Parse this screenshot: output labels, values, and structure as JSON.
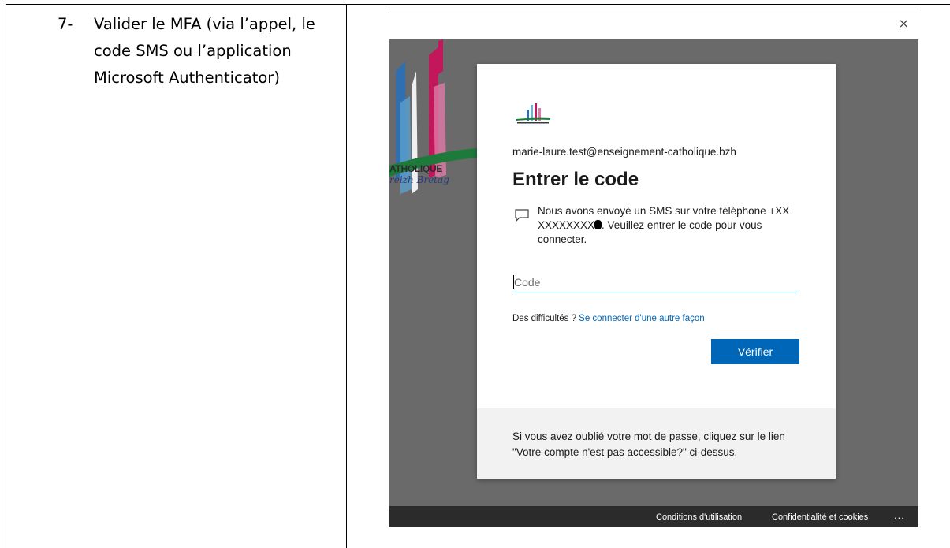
{
  "document": {
    "step_number": "7-",
    "step_text": "Valider le MFA (via l’appel, le code SMS ou l’application Microsoft Authenticator)"
  },
  "window": {
    "close_icon": "close-icon",
    "close_glyph": "×"
  },
  "background": {
    "logo_text": "ATHOLIQUE",
    "logo_subtext": "reizh Bretag"
  },
  "dialog": {
    "email": "marie-laure.test@enseignement-catholique.bzh",
    "title": "Entrer le code",
    "sms_icon": "chat-bubble-icon",
    "message_part1": "Nous avons envoyé un SMS sur votre téléphone +XX XXXXXXXX",
    "message_part2": ". Veuillez entrer le code pour vous connecter.",
    "code_placeholder": "Code",
    "help_prefix": "Des difficultés ? ",
    "help_link": "Se connecter d'une autre façon",
    "verify_label": "Vérifier",
    "footer_text": "Si vous avez oublié votre mot de passe, cliquez sur le lien \"Votre compte n'est pas accessible?\" ci-dessus."
  },
  "bottom_bar": {
    "terms": "Conditions d'utilisation",
    "privacy": "Confidentialité et cookies",
    "more": "..."
  },
  "colors": {
    "accent": "#0067b8",
    "backdrop": "#6a6a6a",
    "bottom_bar": "#2b2b2b"
  }
}
